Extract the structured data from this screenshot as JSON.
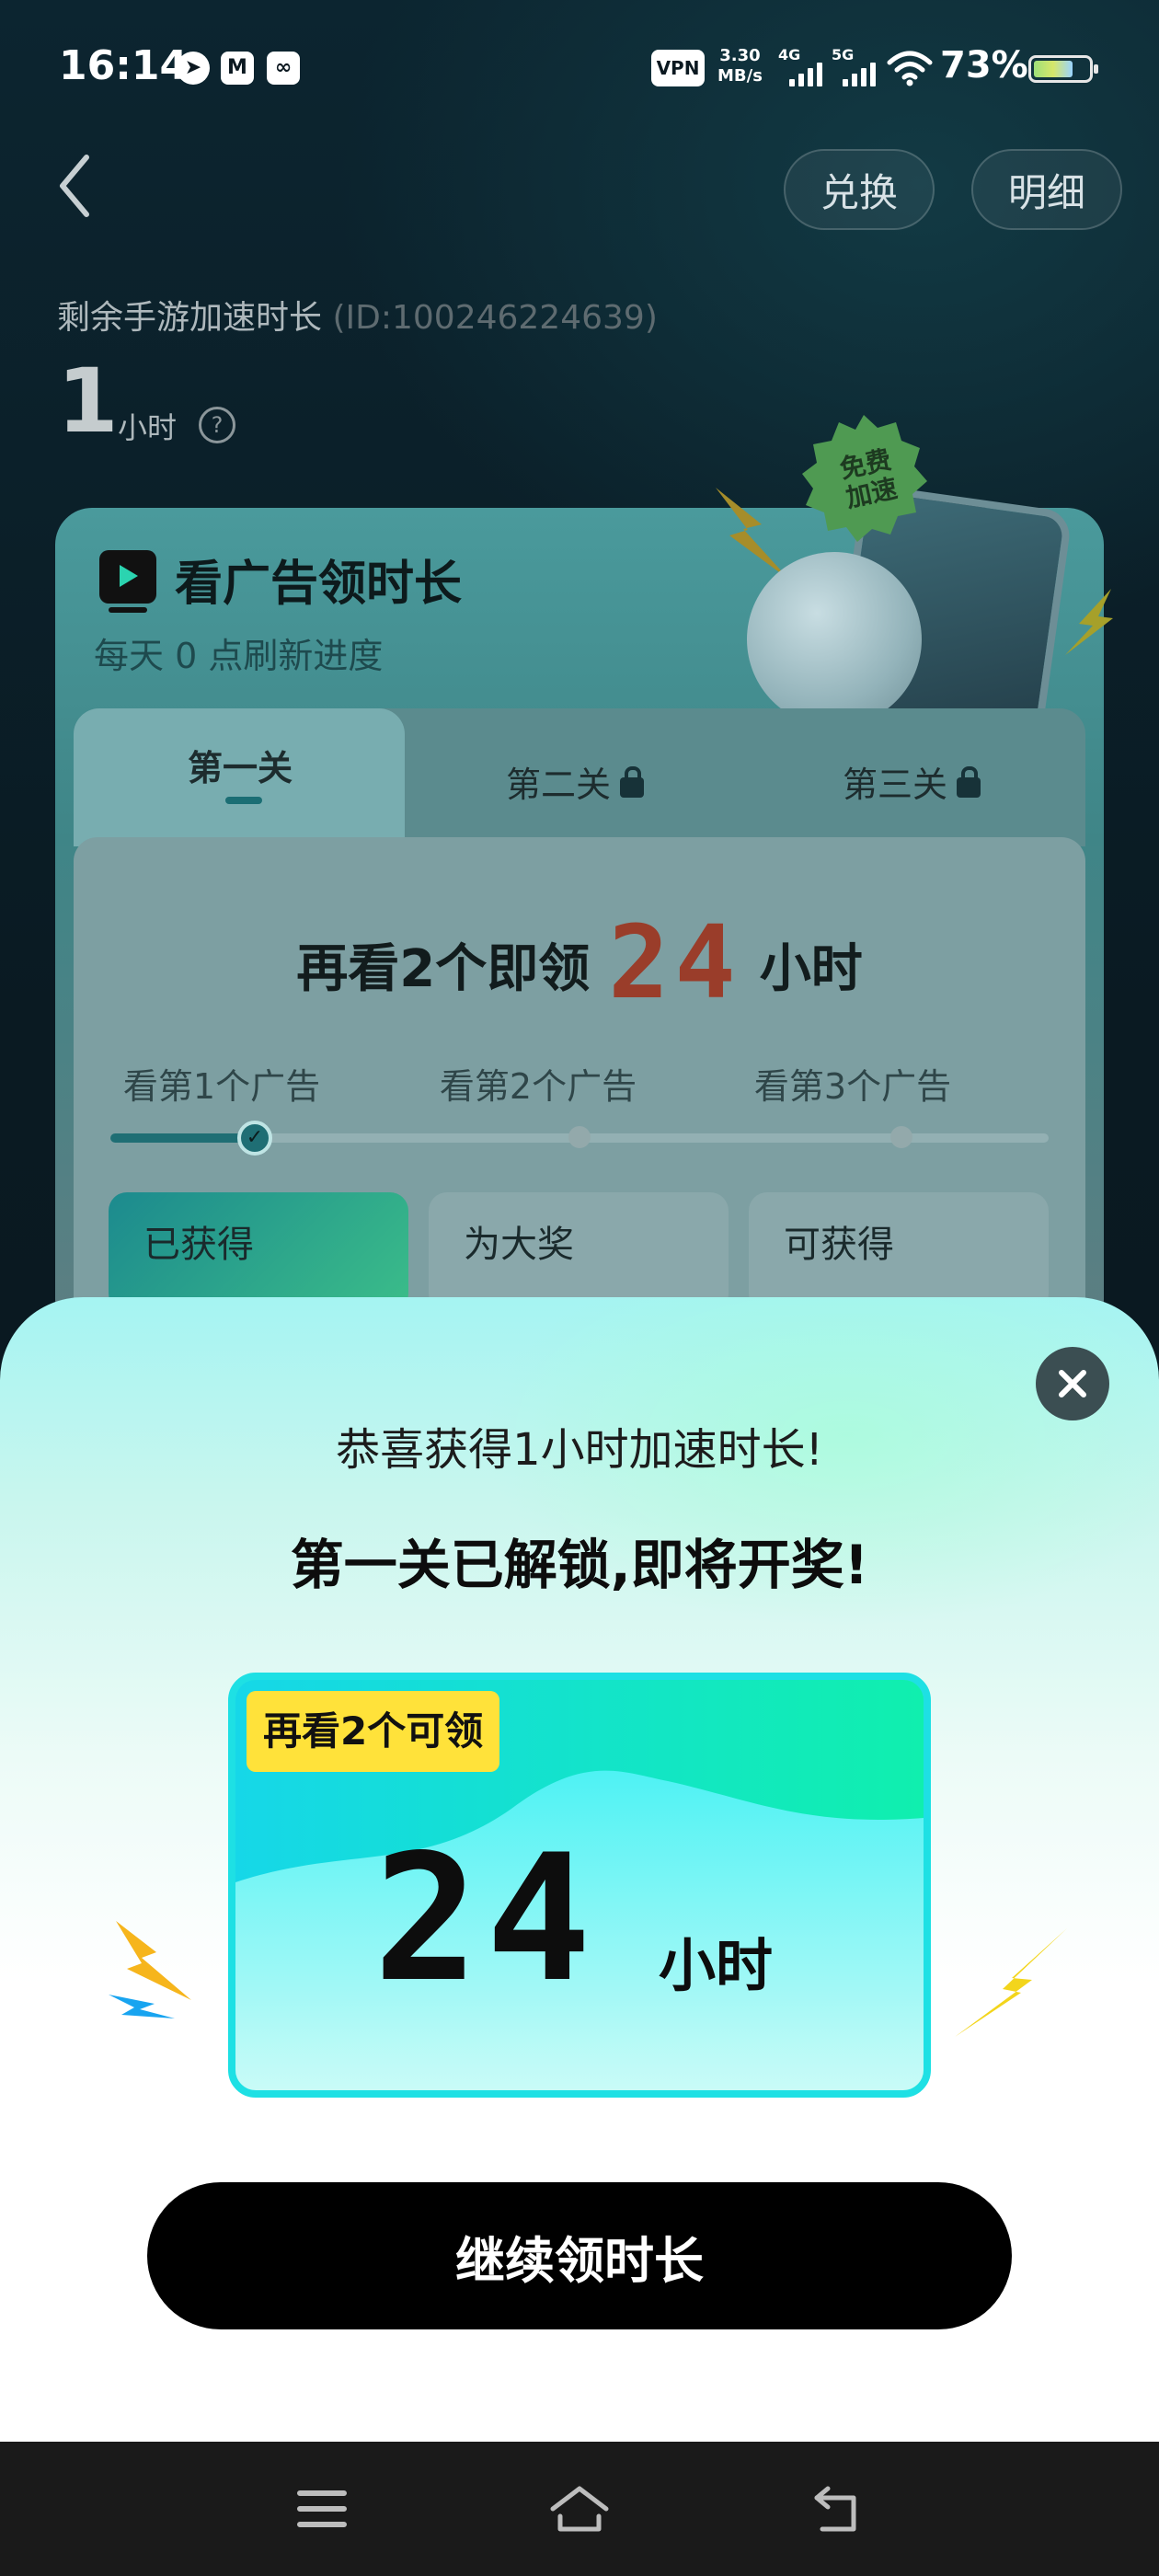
{
  "status_bar": {
    "time": "16:14",
    "app_icons": [
      "telegram-icon",
      "mail-icon",
      "vpn-app-icon"
    ],
    "vpn_label": "VPN",
    "net_speed_value": "3.30",
    "net_speed_unit": "MB/s",
    "signal_1_type": "4G",
    "signal_2_type": "5G",
    "battery_percent": "73%",
    "battery_level": 0.73
  },
  "header": {
    "exchange_label": "兑换",
    "details_label": "明细"
  },
  "summary": {
    "label": "剩余手游加速时长",
    "id_text": "(ID:100246224639)",
    "value": "1",
    "unit": "小时",
    "help_glyph": "?"
  },
  "task_card": {
    "title": "看广告领时长",
    "subtitle": "每天 0 点刷新进度",
    "badge_text": "免费加速",
    "tabs": [
      {
        "label": "第一关",
        "locked": false
      },
      {
        "label": "第二关",
        "locked": true
      },
      {
        "label": "第三关",
        "locked": true
      }
    ],
    "headline_prefix": "再看2个即领",
    "headline_number": "24",
    "headline_unit": "小时",
    "steps": [
      "看第1个广告",
      "看第2个广告",
      "看第3个广告"
    ],
    "progress_fraction": 0.14,
    "rewards": [
      "已获得",
      "为大奖",
      "可获得"
    ]
  },
  "dialog": {
    "congrats": "恭喜获得1小时加速时长!",
    "unlock_title": "第一关已解锁,即将开奖!",
    "prize_tag": "再看2个可领",
    "prize_number": "24",
    "prize_unit": "小时",
    "continue_label": "继续领时长"
  },
  "colors": {
    "accent_teal": "#1ee0e4",
    "prize_tag_yellow": "#ffe23a",
    "headline_red": "#c2412a"
  }
}
